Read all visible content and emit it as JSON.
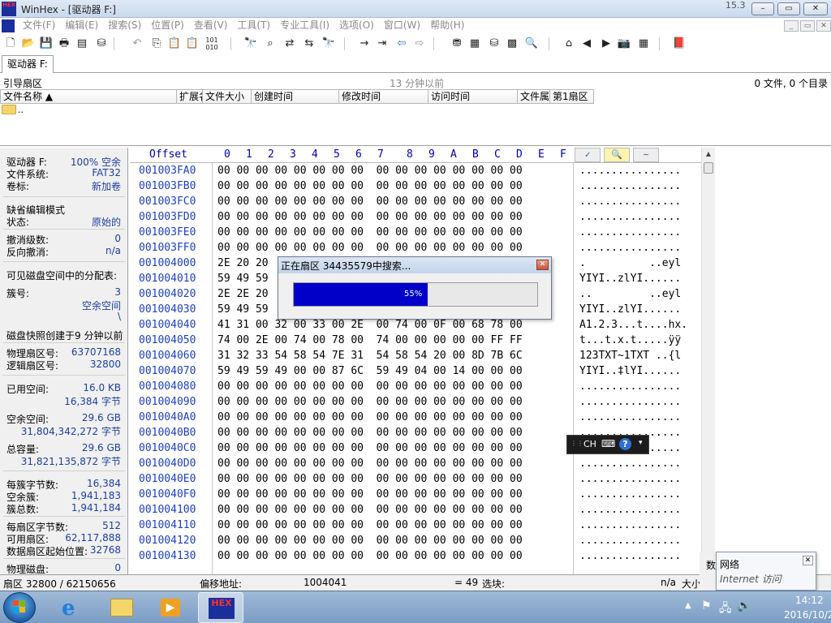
{
  "window": {
    "title": "WinHex - [驱动器 F:]",
    "logo_text": "HEX",
    "version": "15.3",
    "controls": {
      "minimize": "–",
      "maximize": "▭",
      "close": "✕"
    }
  },
  "menu": {
    "items": [
      "文件(F)",
      "编辑(E)",
      "搜索(S)",
      "位置(P)",
      "查看(V)",
      "工具(T)",
      "专业工具(I)",
      "选项(O)",
      "窗口(W)",
      "帮助(H)"
    ],
    "mdi": {
      "minimize": "_",
      "restore": "▭",
      "close": "✕"
    }
  },
  "tab": {
    "label": "驱动器 F:"
  },
  "directory": {
    "label": "引导扇区",
    "time": "13 分钟以前",
    "count": "0 文件, 0 个目录"
  },
  "filelist": {
    "columns": [
      "文件名称 ▲",
      "扩展名",
      "文件大小",
      "创建时间",
      "修改时间",
      "访问时间",
      "文件属性",
      "第1扇区"
    ],
    "rows": [
      {
        "name": ".."
      }
    ]
  },
  "info": {
    "drive_label": "驱动器 F:",
    "drive_value": "100% 空余",
    "fs_label": "文件系统:",
    "fs_value": "FAT32",
    "vol_label": "卷标:",
    "vol_value": "新加卷",
    "mode_label": "缺省编辑模式",
    "state_label": "状态:",
    "state_value": "原始的",
    "undo_label": "撤消级数:",
    "undo_value": "0",
    "redo_label": "反向撤消:",
    "redo_value": "n/a",
    "alloc_label": "可见磁盘空间中的分配表:",
    "cluster_label": "簇号:",
    "cluster_value": "3",
    "cluster_value2": "空余空间",
    "cluster_value3": "\\",
    "snapshot_label": "磁盘快照创建于9 分钟以前",
    "phys_sector_label": "物理扇区号:",
    "phys_sector_value": "63707168",
    "logic_sector_label": "逻辑扇区号:",
    "logic_sector_value": "32800",
    "used_label": "已用空间:",
    "used_value": "16.0 KB",
    "used_bytes": "16,384 字节",
    "free_label": "空余空间:",
    "free_value": "29.6 GB",
    "free_bytes": "31,804,342,272 字节",
    "total_label": "总容量:",
    "total_value": "29.6 GB",
    "total_bytes": "31,821,135,872 字节",
    "bpc_label": "每簇字节数:",
    "bpc_value": "16,384",
    "free_clusters_label": "空余簇:",
    "free_clusters_value": "1,941,183",
    "total_clusters_label": "簇总数:",
    "total_clusters_value": "1,941,184",
    "bps_label": "每扇区字节数:",
    "bps_value": "512",
    "avail_sectors_label": "可用扇区:",
    "avail_sectors_value": "62,117,888",
    "data_start_label": "数据扇区起始位置:",
    "data_start_value": "32768",
    "phys_disk_label": "物理磁盘:",
    "phys_disk_value": "0"
  },
  "hex": {
    "offset_label": "Offset",
    "columns": [
      "0",
      "1",
      "2",
      "3",
      "4",
      "5",
      "6",
      "7",
      "8",
      "9",
      "A",
      "B",
      "C",
      "D",
      "E",
      "F"
    ],
    "rows": [
      {
        "offset": "001003FA0",
        "bytes": "00 00 00 00 00 00 00 00  00 00 00 00 00 00 00 00",
        "ascii": "................"
      },
      {
        "offset": "001003FB0",
        "bytes": "00 00 00 00 00 00 00 00  00 00 00 00 00 00 00 00",
        "ascii": "................"
      },
      {
        "offset": "001003FC0",
        "bytes": "00 00 00 00 00 00 00 00  00 00 00 00 00 00 00 00",
        "ascii": "................"
      },
      {
        "offset": "001003FD0",
        "bytes": "00 00 00 00 00 00 00 00  00 00 00 00 00 00 00 00",
        "ascii": "................"
      },
      {
        "offset": "001003FE0",
        "bytes": "00 00 00 00 00 00 00 00  00 00 00 00 00 00 00 00",
        "ascii": "................"
      },
      {
        "offset": "001003FF0",
        "bytes": "00 00 00 00 00 00 00 00  00 00 00 00 00 00 00 00",
        "ascii": "................"
      },
      {
        "offset": "001004000",
        "bytes": "2E 20 20                                      6C",
        "ascii": ".          ..eyl"
      },
      {
        "offset": "001004010",
        "bytes": "59 49 59                                      00",
        "ascii": "YIYI..zlYI......"
      },
      {
        "offset": "001004020",
        "bytes": "2E 2E 20                                      6C",
        "ascii": "..         ..eyl"
      },
      {
        "offset": "001004030",
        "bytes": "59 49 59                                      00",
        "ascii": "YIYI..zlYI......"
      },
      {
        "offset": "001004040",
        "bytes": "41 31 00 32 00 33 00 2E  00 74 00 0F 00 68 78 00",
        "ascii": "A1.2.3...t....hx."
      },
      {
        "offset": "001004050",
        "bytes": "74 00 2E 00 74 00 78 00  74 00 00 00 00 00 FF FF",
        "ascii": "t...t.x.t.....ÿÿ"
      },
      {
        "offset": "001004060",
        "bytes": "31 32 33 54 58 54 7E 31  54 58 54 20 00 8D 7B 6C",
        "ascii": "123TXT~1TXT ..{l"
      },
      {
        "offset": "001004070",
        "bytes": "59 49 59 49 00 00 87 6C  59 49 04 00 14 00 00 00",
        "ascii": "YIYI..‡lYI......"
      },
      {
        "offset": "001004080",
        "bytes": "00 00 00 00 00 00 00 00  00 00 00 00 00 00 00 00",
        "ascii": "................"
      },
      {
        "offset": "001004090",
        "bytes": "00 00 00 00 00 00 00 00  00 00 00 00 00 00 00 00",
        "ascii": "................"
      },
      {
        "offset": "0010040A0",
        "bytes": "00 00 00 00 00 00 00 00  00 00 00 00 00 00 00 00",
        "ascii": "................"
      },
      {
        "offset": "0010040B0",
        "bytes": "00 00 00 00 00 00 00 00  00 00 00 00 00 00 00 00",
        "ascii": "................"
      },
      {
        "offset": "0010040C0",
        "bytes": "00 00 00 00 00 00 00 00  00 00 00 00 00 00 00 00",
        "ascii": "................"
      },
      {
        "offset": "0010040D0",
        "bytes": "00 00 00 00 00 00 00 00  00 00 00 00 00 00 00 00",
        "ascii": "................"
      },
      {
        "offset": "0010040E0",
        "bytes": "00 00 00 00 00 00 00 00  00 00 00 00 00 00 00 00",
        "ascii": "................"
      },
      {
        "offset": "0010040F0",
        "bytes": "00 00 00 00 00 00 00 00  00 00 00 00 00 00 00 00",
        "ascii": "................"
      },
      {
        "offset": "001004100",
        "bytes": "00 00 00 00 00 00 00 00  00 00 00 00 00 00 00 00",
        "ascii": "................"
      },
      {
        "offset": "001004110",
        "bytes": "00 00 00 00 00 00 00 00  00 00 00 00 00 00 00 00",
        "ascii": "................"
      },
      {
        "offset": "001004120",
        "bytes": "00 00 00 00 00 00 00 00  00 00 00 00 00 00 00 00",
        "ascii": "................"
      },
      {
        "offset": "001004130",
        "bytes": "00 00 00 00 00 00 00 00  00 00 00 00 00 00 00 00",
        "ascii": "................"
      }
    ]
  },
  "status": {
    "sector": "扇区 32800 / 62150656",
    "offset_label": "偏移地址:",
    "offset_value": "1004041",
    "value": "= 49",
    "selection_label": "选块:",
    "na": "n/a",
    "size_label": "大小"
  },
  "progress": {
    "title": "正在扇区 34435579中搜索...",
    "percent_label": "55%",
    "percent": 55,
    "close": "✕"
  },
  "ime": {
    "lang": "CH"
  },
  "notification": {
    "title": "网络",
    "subtitle": "Internet 访问",
    "behind": "数"
  },
  "taskbar": {
    "time": "14:12",
    "date": "2016/10/25"
  },
  "colors": {
    "accent": "#0000c8",
    "offset": "#1e3fbe",
    "info_value": "#1e3f9e"
  }
}
